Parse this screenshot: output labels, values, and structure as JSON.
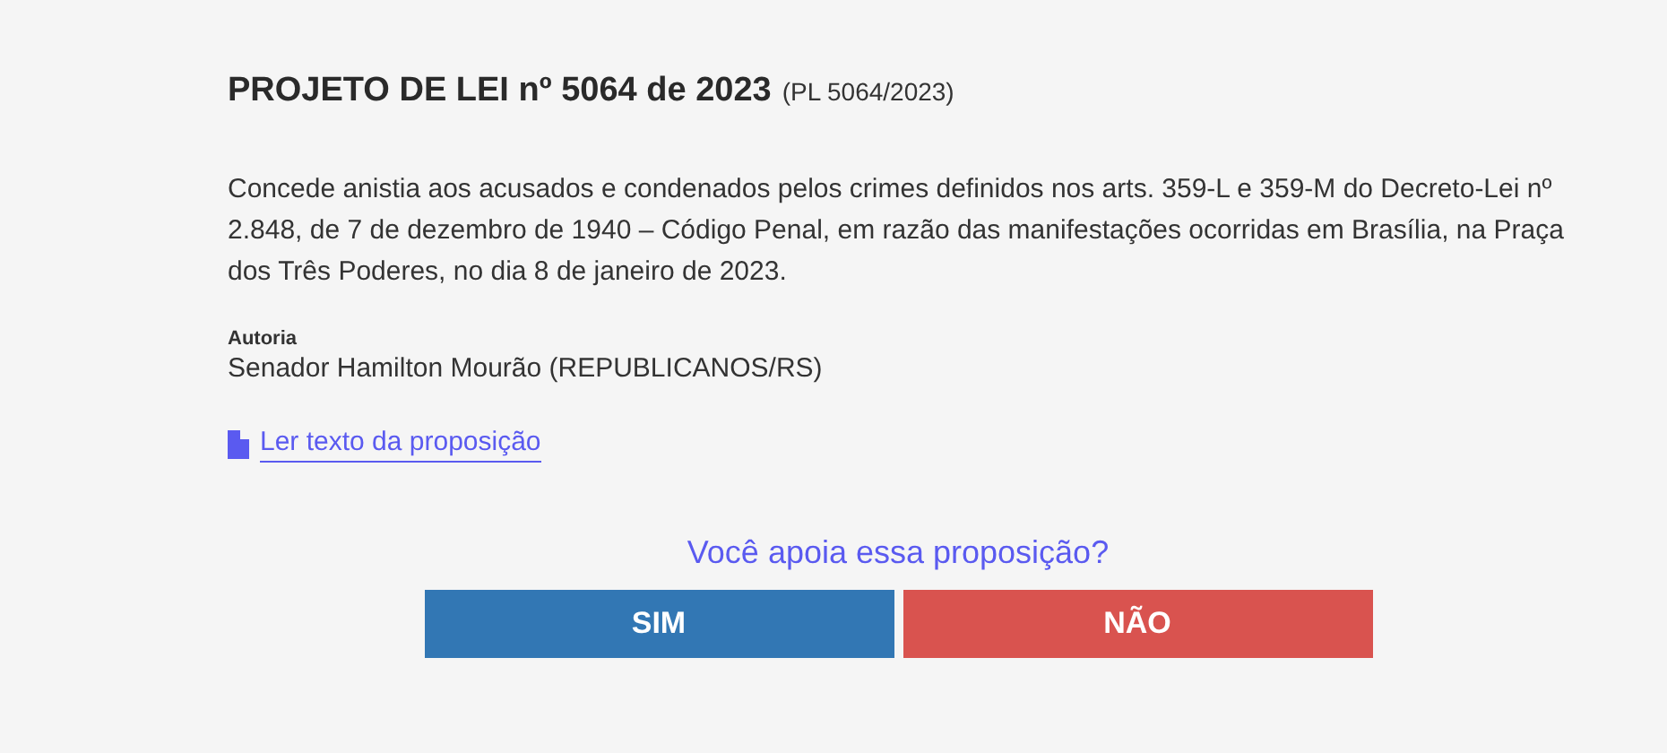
{
  "title": {
    "main": "PROJETO DE LEI nº 5064 de 2023",
    "code": "(PL 5064/2023)"
  },
  "summary": "Concede anistia aos acusados e condenados pelos crimes definidos nos arts. 359-L e 359-M do Decreto-Lei nº 2.848, de 7 de dezembro de 1940 – Código Penal, em razão das manifestações ocorridas em Brasília, na Praça dos Três Poderes, no dia 8 de janeiro de 2023.",
  "authorship": {
    "label": "Autoria",
    "value": "Senador Hamilton Mourão (REPUBLICANOS/RS)"
  },
  "document_link": "Ler texto da proposição",
  "vote": {
    "question": "Você apoia essa proposição?",
    "buttons": [
      {
        "label": "SIM",
        "kind": "yes"
      },
      {
        "label": "NÃO",
        "kind": "no"
      }
    ]
  }
}
